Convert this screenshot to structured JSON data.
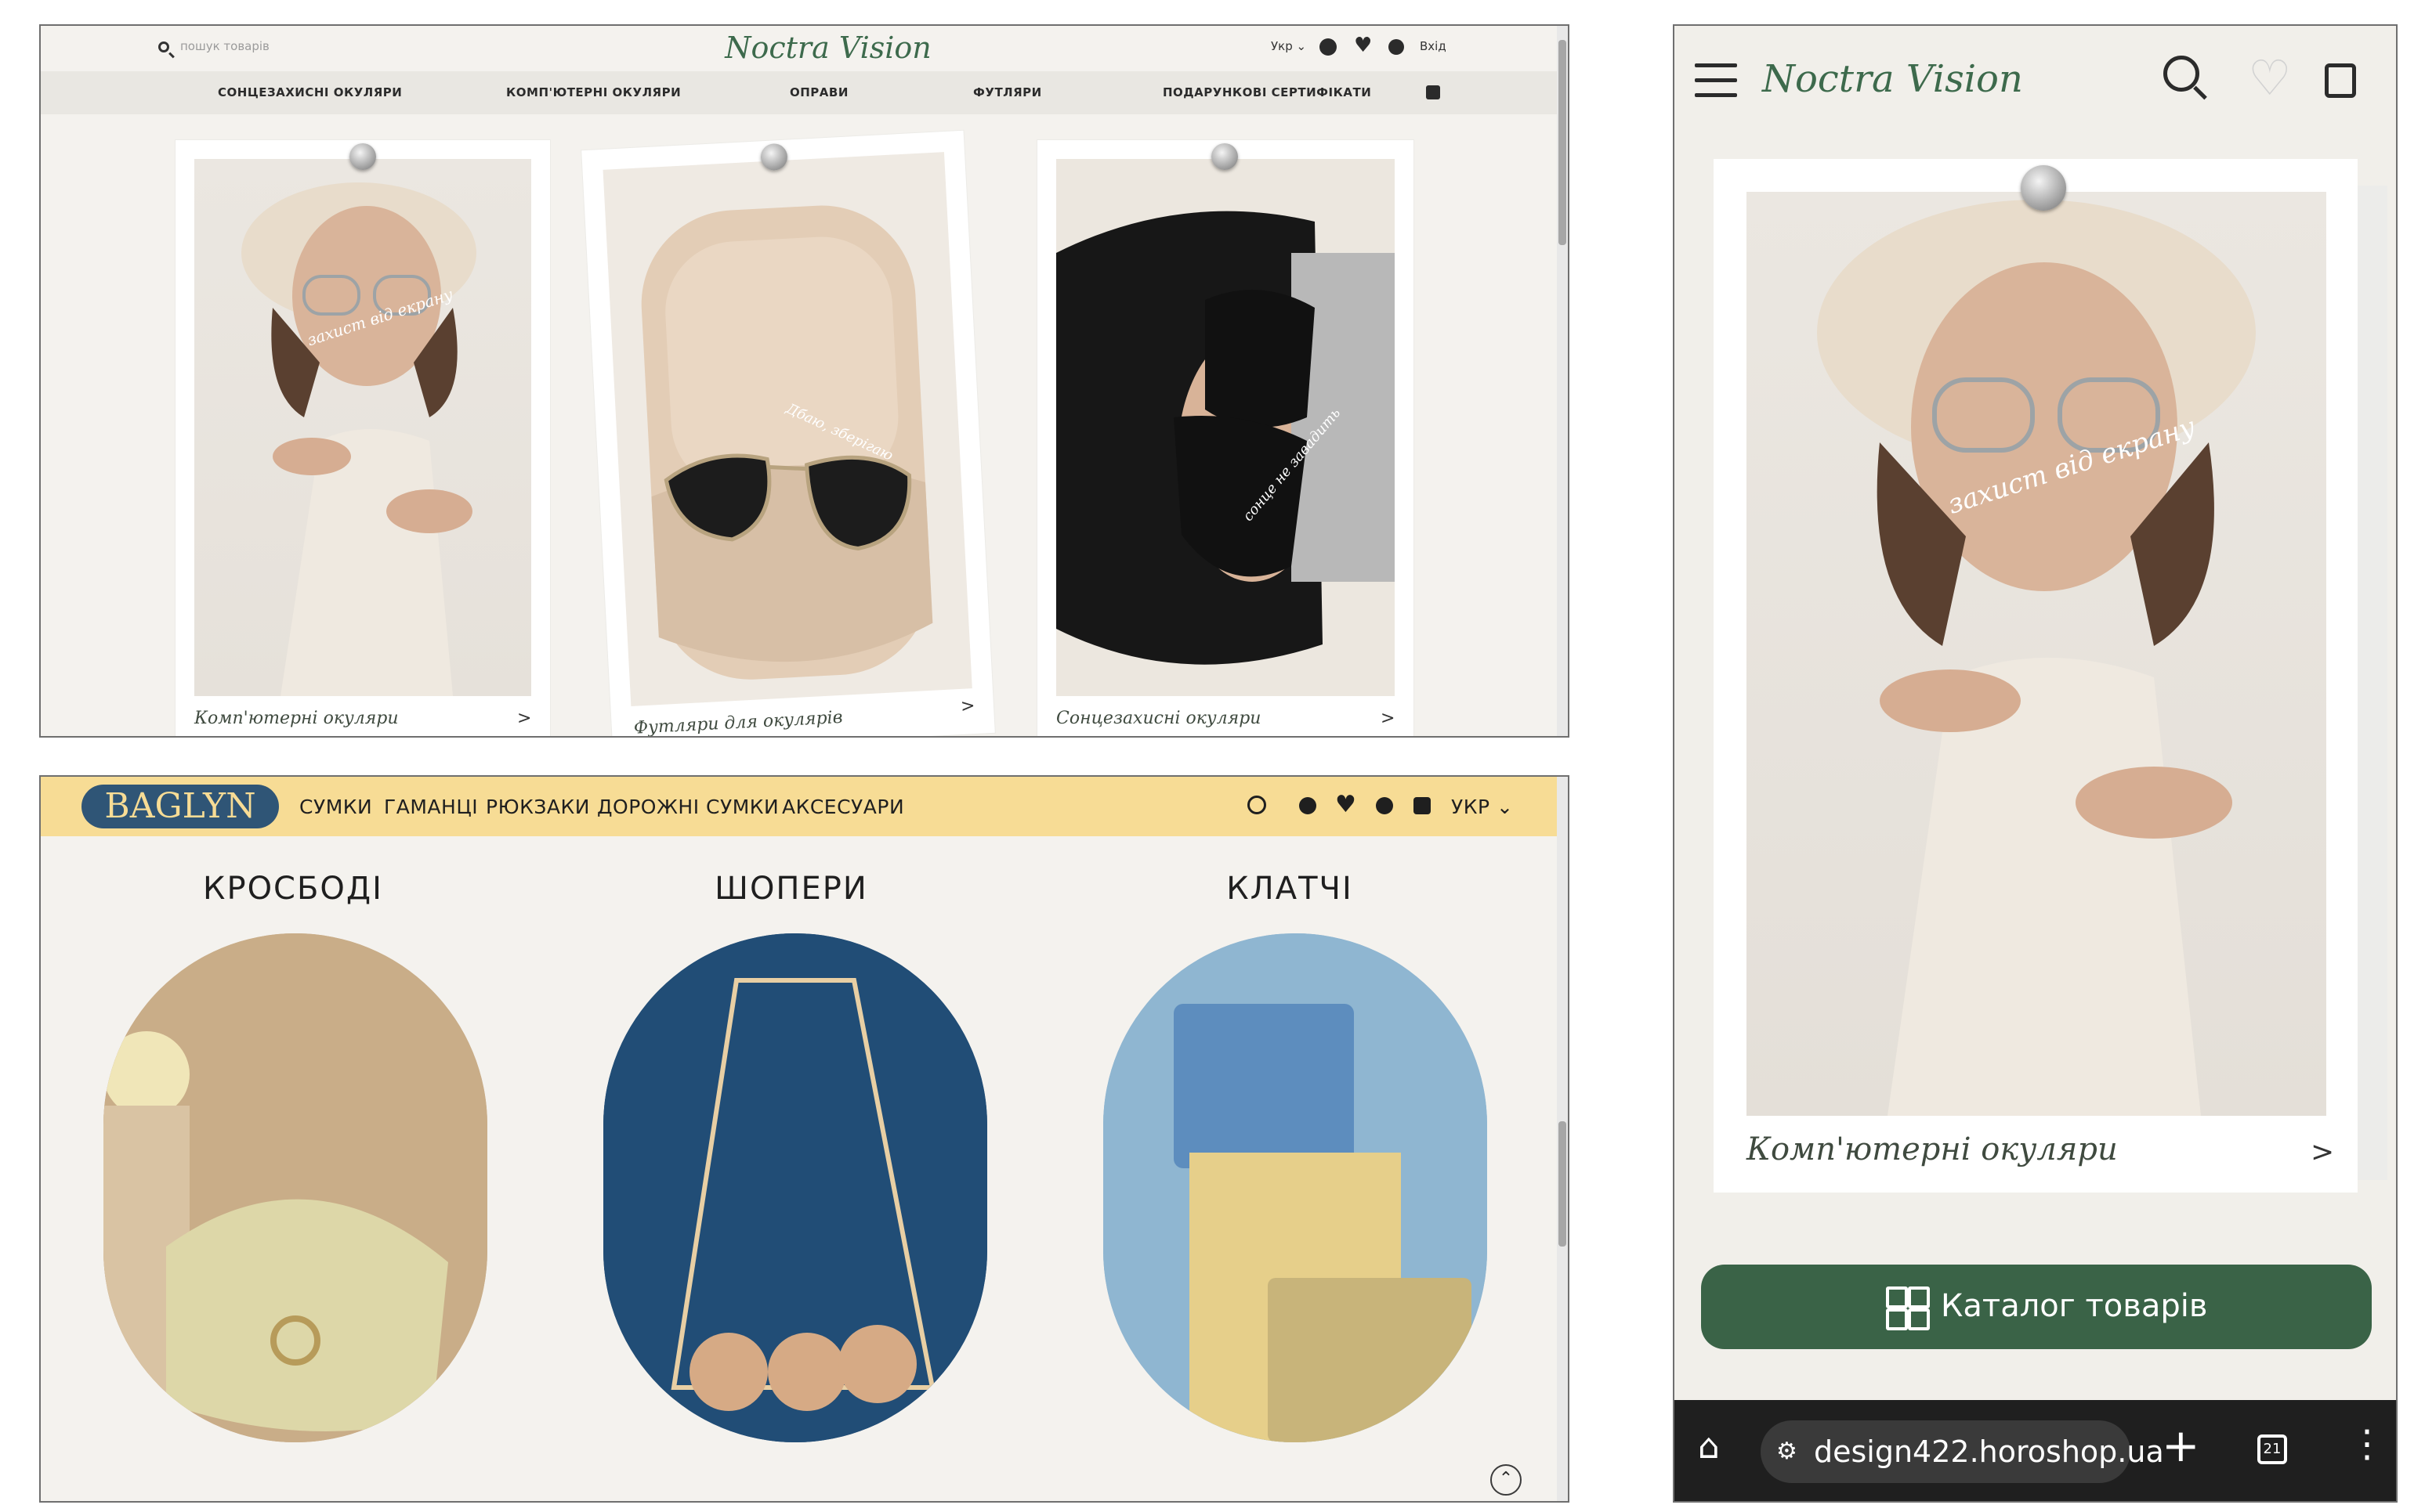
{
  "noctra": {
    "search_placeholder": "пошук товарів",
    "logo": "Noctra Vision",
    "lang": "Укр",
    "login": "Вхід",
    "nav": [
      "СОНЦЕЗАХИСНІ ОКУЛЯРИ",
      "КОМП'ЮТЕРНІ ОКУЛЯРИ",
      "ОПРАВИ",
      "ФУТЛЯРИ",
      "ПОДАРУНКОВІ СЕРТИФІКАТИ"
    ],
    "cards": [
      {
        "caption": "Комп'ютерні окуляри",
        "overlay": "захист від екрану",
        "arrow": ">"
      },
      {
        "caption": "Футляри для окулярів",
        "overlay": "Дбаю, зберігаю",
        "arrow": ">"
      },
      {
        "caption": "Сонцезахисні окуляри",
        "overlay": "сонце не завадить",
        "arrow": ">"
      }
    ]
  },
  "baglyn": {
    "logo": "BAGLYN",
    "nav": [
      "СУМКИ",
      "ГАМАНЦІ",
      "РЮКЗАКИ",
      "ДОРОЖНІ СУМКИ",
      "АКСЕСУАРИ"
    ],
    "lang": "УКР",
    "categories": [
      "КРОСБОДІ",
      "ШОПЕРИ",
      "КЛАТЧІ"
    ]
  },
  "mobile": {
    "logo": "Noctra Vision",
    "card_caption": "Комп'ютерні окуляри",
    "card_overlay": "захист від екрану",
    "arrow": ">",
    "catalog_button": "Каталог товарів",
    "url": "design422.horoshop.ua",
    "tabs_count": "21"
  },
  "colors": {
    "green": "#3a6347",
    "baglyn_yellow": "#f7dc95",
    "baglyn_navy": "#2f5576",
    "page_bg": "#f4f2ee"
  }
}
